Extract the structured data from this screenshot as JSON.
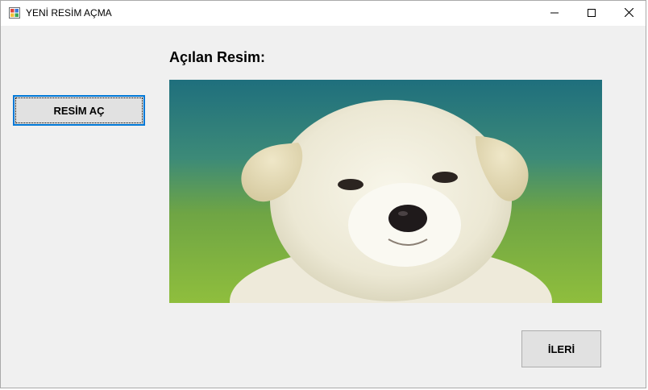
{
  "window": {
    "title": "YENİ RESİM AÇMA",
    "icons": {
      "app": "app-window-icon",
      "minimize": "minimize-icon",
      "maximize": "maximize-icon",
      "close": "close-icon"
    }
  },
  "main": {
    "open_button_label": "RESİM AÇ",
    "heading": "Açılan Resim:",
    "image_subject": "puppy-photo",
    "next_button_label": "İLERİ"
  },
  "colors": {
    "window_bg": "#f0f0f0",
    "button_bg": "#e1e1e1",
    "focus_border": "#0078d7"
  }
}
